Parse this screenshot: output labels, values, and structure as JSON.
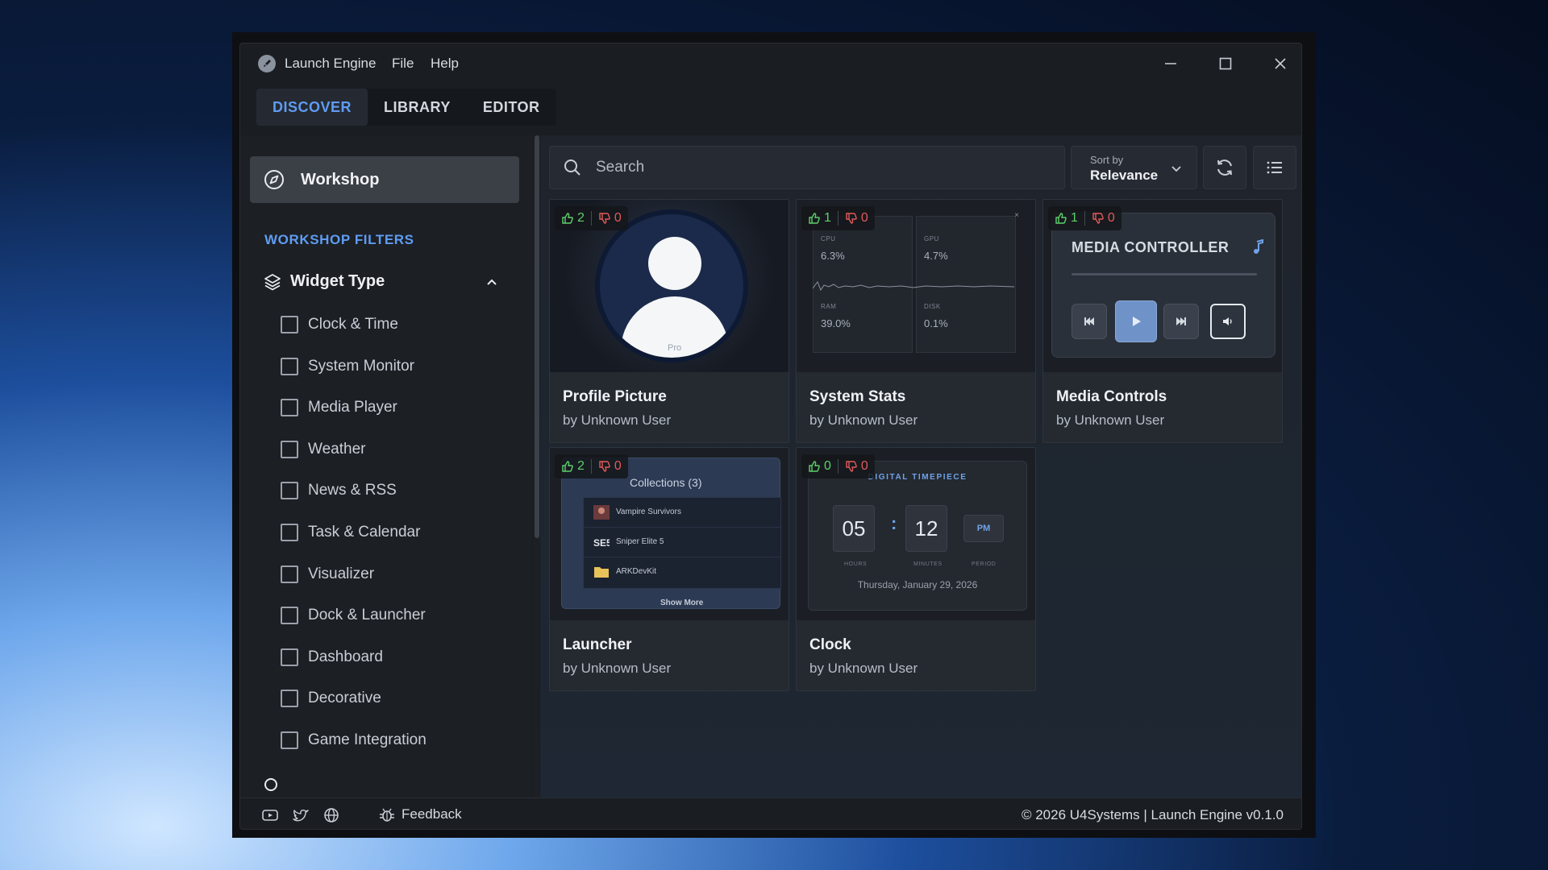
{
  "app": {
    "title": "Launch Engine",
    "menu": [
      "File",
      "Help"
    ]
  },
  "tabs": [
    {
      "label": "DISCOVER",
      "active": true
    },
    {
      "label": "LIBRARY",
      "active": false
    },
    {
      "label": "EDITOR",
      "active": false
    }
  ],
  "sidebar": {
    "workshop_label": "Workshop",
    "filters_heading": "WORKSHOP FILTERS",
    "group_label": "Widget Type",
    "filters": [
      "Clock & Time",
      "System Monitor",
      "Media Player",
      "Weather",
      "News & RSS",
      "Task & Calendar",
      "Visualizer",
      "Dock & Launcher",
      "Dashboard",
      "Decorative",
      "Game Integration"
    ]
  },
  "toolbar": {
    "search_placeholder": "Search",
    "sort_caption": "Sort by",
    "sort_value": "Relevance"
  },
  "cards": [
    {
      "name": "Profile Picture",
      "author": "by Unknown User",
      "up": "2",
      "down": "0"
    },
    {
      "name": "System Stats",
      "author": "by Unknown User",
      "up": "1",
      "down": "0"
    },
    {
      "name": "Media Controls",
      "author": "by Unknown User",
      "up": "1",
      "down": "0"
    },
    {
      "name": "Launcher",
      "author": "by Unknown User",
      "up": "2",
      "down": "0"
    },
    {
      "name": "Clock",
      "author": "by Unknown User",
      "up": "0",
      "down": "0"
    }
  ],
  "previews": {
    "profile_tag": "Pro",
    "stats": {
      "labels": [
        "CPU",
        "GPU",
        "RAM",
        "DISK"
      ],
      "values": [
        "6.3%",
        "4.7%",
        "39.0%",
        "0.1%"
      ],
      "close": "×"
    },
    "media": {
      "title": "MEDIA CONTROLLER"
    },
    "launcher": {
      "heading": "Collections (3)",
      "items": [
        {
          "title": "Vampire Survivors"
        },
        {
          "title": "Sniper Elite 5"
        },
        {
          "title": "ARKDevKit"
        }
      ],
      "more": "Show More"
    },
    "clock": {
      "title": "DIGITAL TIMEPIECE",
      "hours": "05",
      "minutes": "12",
      "period": "PM",
      "cap_hours": "HOURS",
      "cap_minutes": "MINUTES",
      "cap_period": "PERIOD",
      "date": "Thursday, January 29, 2026"
    }
  },
  "footer": {
    "feedback": "Feedback",
    "copyright": "© 2026 U4Systems | Launch Engine v0.1.0"
  },
  "colors": {
    "accent": "#5f9cf2",
    "upvote": "#5fd06b",
    "downvote": "#e05a5a"
  }
}
